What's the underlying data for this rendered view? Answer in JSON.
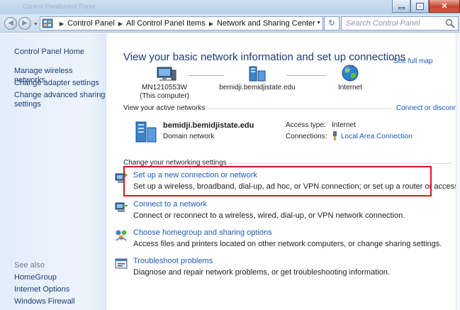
{
  "window": {
    "ghost_tabs": [
      "Control Panel",
      "Control Panel"
    ]
  },
  "addressbar": {
    "crumbs": [
      "Control Panel",
      "All Control Panel Items",
      "Network and Sharing Center"
    ],
    "search_placeholder": "Search Control Panel"
  },
  "sidebar": {
    "home": "Control Panel Home",
    "items": [
      "Manage wireless networks",
      "Change adapter settings",
      "Change advanced sharing",
      "settings"
    ],
    "see_also_label": "See also",
    "see_also": [
      "HomeGroup",
      "Internet Options",
      "Windows Firewall"
    ]
  },
  "main": {
    "heading": "View your basic network information and set up connections",
    "see_full_map": "See full map",
    "map": {
      "computer_name": "MN1210553W",
      "computer_sub": "(This computer)",
      "domain": "bemidji.bemidjistate.edu",
      "internet": "Internet"
    },
    "active_networks": {
      "label": "View your active networks",
      "connect_link": "Connect or disconnect",
      "network_name": "bemidji.bemidjistate.edu",
      "network_type": "Domain network",
      "access_type_label": "Access type:",
      "access_type_value": "Internet",
      "connections_label": "Connections:",
      "connections_value": "Local Area Connection"
    },
    "change_settings_label": "Change your networking settings",
    "tasks": [
      {
        "title": "Set up a new connection or network",
        "desc": "Set up a wireless, broadband, dial-up, ad hoc, or VPN connection; or set up a router or access point."
      },
      {
        "title": "Connect to a network",
        "desc": "Connect or reconnect to a wireless, wired, dial-up, or VPN network connection."
      },
      {
        "title": "Choose homegroup and sharing options",
        "desc": "Access files and printers located on other network computers, or change sharing settings."
      },
      {
        "title": "Troubleshoot problems",
        "desc": "Diagnose and repair network problems, or get troubleshooting information."
      }
    ]
  },
  "colors": {
    "link": "#1a5bb7",
    "heading": "#1e3a78",
    "highlight_border": "#e0131c"
  }
}
